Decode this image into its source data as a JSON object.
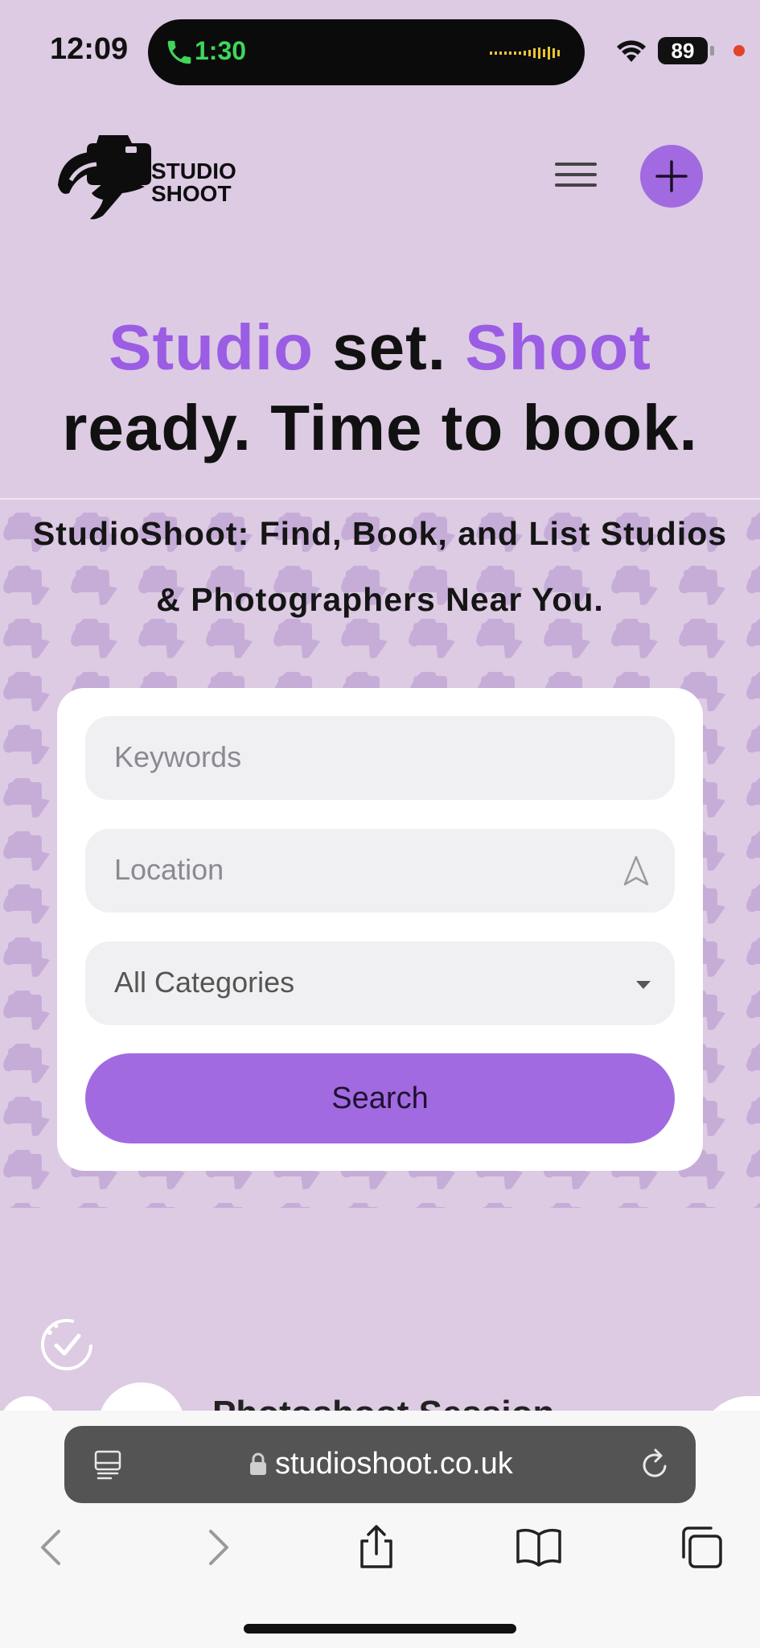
{
  "status_bar": {
    "time": "12:09",
    "call_time": "1:30",
    "battery": "89"
  },
  "header": {
    "logo_text_line1": "STUDIO",
    "logo_text_line2": "SHOOT",
    "menu_icon": "hamburger-icon",
    "add_icon": "plus-icon"
  },
  "hero": {
    "title_word1": "Studio",
    "title_word2": " set. ",
    "title_word3": "Shoot",
    "title_line2": "ready. Time to book.",
    "subtitle": "StudioShoot: Find, Book, and List Studios & Photographers Near You.",
    "accent_color": "#9b5de3"
  },
  "search": {
    "keywords_placeholder": "Keywords",
    "location_placeholder": "Location",
    "category_value": "All Categories",
    "search_label": "Search",
    "button_color": "#a26ae0"
  },
  "listing_preview": {
    "title": "Photoshoot Session"
  },
  "browser": {
    "url": "studioshoot.co.uk"
  }
}
